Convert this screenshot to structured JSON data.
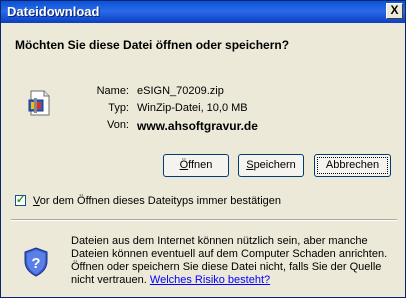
{
  "window": {
    "title": "Dateidownload",
    "close_glyph": "X"
  },
  "question": "Möchten Sie diese Datei öffnen oder speichern?",
  "file": {
    "icon": "zip-file-icon",
    "name_label": "Name:",
    "name_value": "eSIGN_70209.zip",
    "type_label": "Typ:",
    "type_value": "WinZip-Datei, 10,0 MB",
    "from_label": "Von:",
    "from_value": "www.ahsoftgravur.de"
  },
  "buttons": {
    "open": {
      "first": "Ö",
      "rest": "ffnen"
    },
    "save": {
      "first": "S",
      "rest": "peichern"
    },
    "cancel": "Abbrechen"
  },
  "checkbox": {
    "checked": true,
    "label_first": "V",
    "label_rest": "or dem Öffnen dieses Dateityps immer bestätigen"
  },
  "warning": {
    "icon": "security-shield-question-icon",
    "text": "Dateien aus dem Internet können nützlich sein, aber manche Dateien können eventuell auf dem Computer Schaden anrichten. Öffnen oder speichern Sie diese Datei nicht, falls Sie der Quelle nicht vertrauen.",
    "link": "Welches Risiko besteht?"
  },
  "colors": {
    "titlebar": "#0a52d6",
    "dialog_bg": "#ece9d8",
    "link": "#0000ff"
  }
}
